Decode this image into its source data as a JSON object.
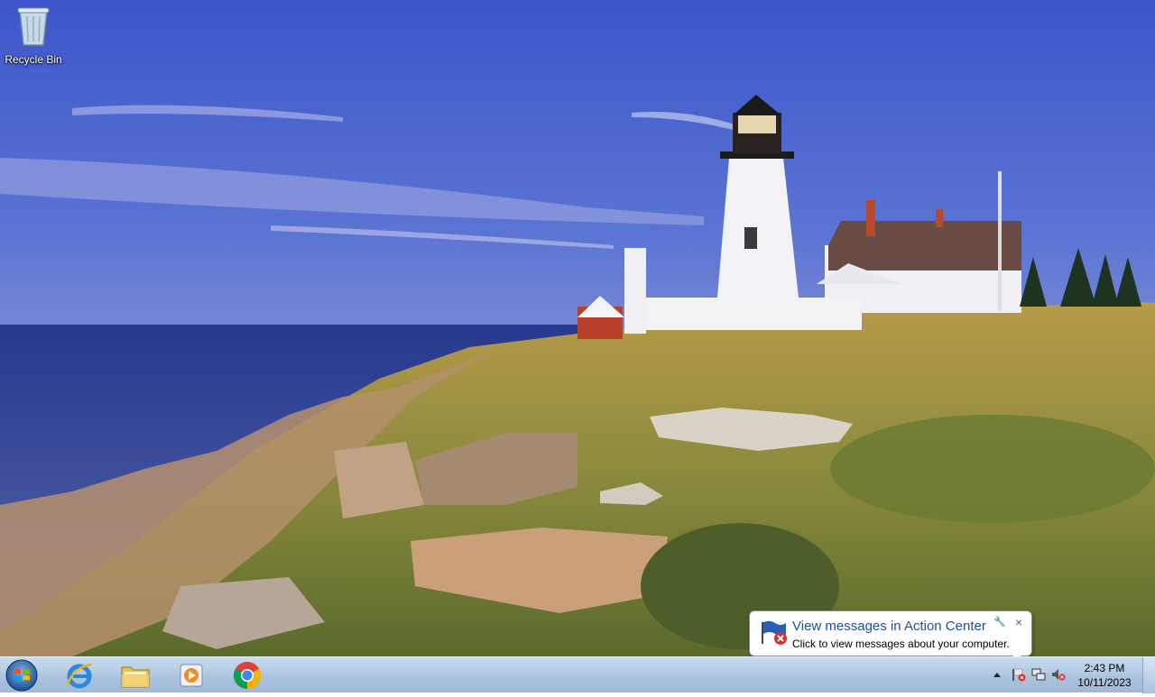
{
  "desktop": {
    "icons": [
      {
        "label": "Recycle Bin",
        "icon": "recycle-bin-icon"
      }
    ],
    "wallpaper": "lighthouse-coast"
  },
  "taskbar": {
    "start": {
      "icon": "windows-start-icon"
    },
    "pinned": [
      {
        "name": "Internet Explorer",
        "icon": "internet-explorer-icon"
      },
      {
        "name": "Windows Explorer",
        "icon": "folder-icon"
      },
      {
        "name": "Windows Media Player",
        "icon": "media-player-icon"
      },
      {
        "name": "Google Chrome",
        "icon": "chrome-icon"
      }
    ],
    "tray": {
      "icons": [
        "show-hidden-icons-icon",
        "action-center-flag-icon",
        "network-icon",
        "volume-muted-icon"
      ],
      "time": "2:43 PM",
      "date": "10/11/2023"
    }
  },
  "notification": {
    "title": "View messages in Action Center",
    "body": "Click to view messages about your computer.",
    "close": "×",
    "icon": "action-center-flag-error-icon"
  },
  "colors": {
    "balloon_title": "#1d4fa0",
    "taskbar_top": "#c9dcef",
    "taskbar_bottom": "#9fb9d6"
  }
}
